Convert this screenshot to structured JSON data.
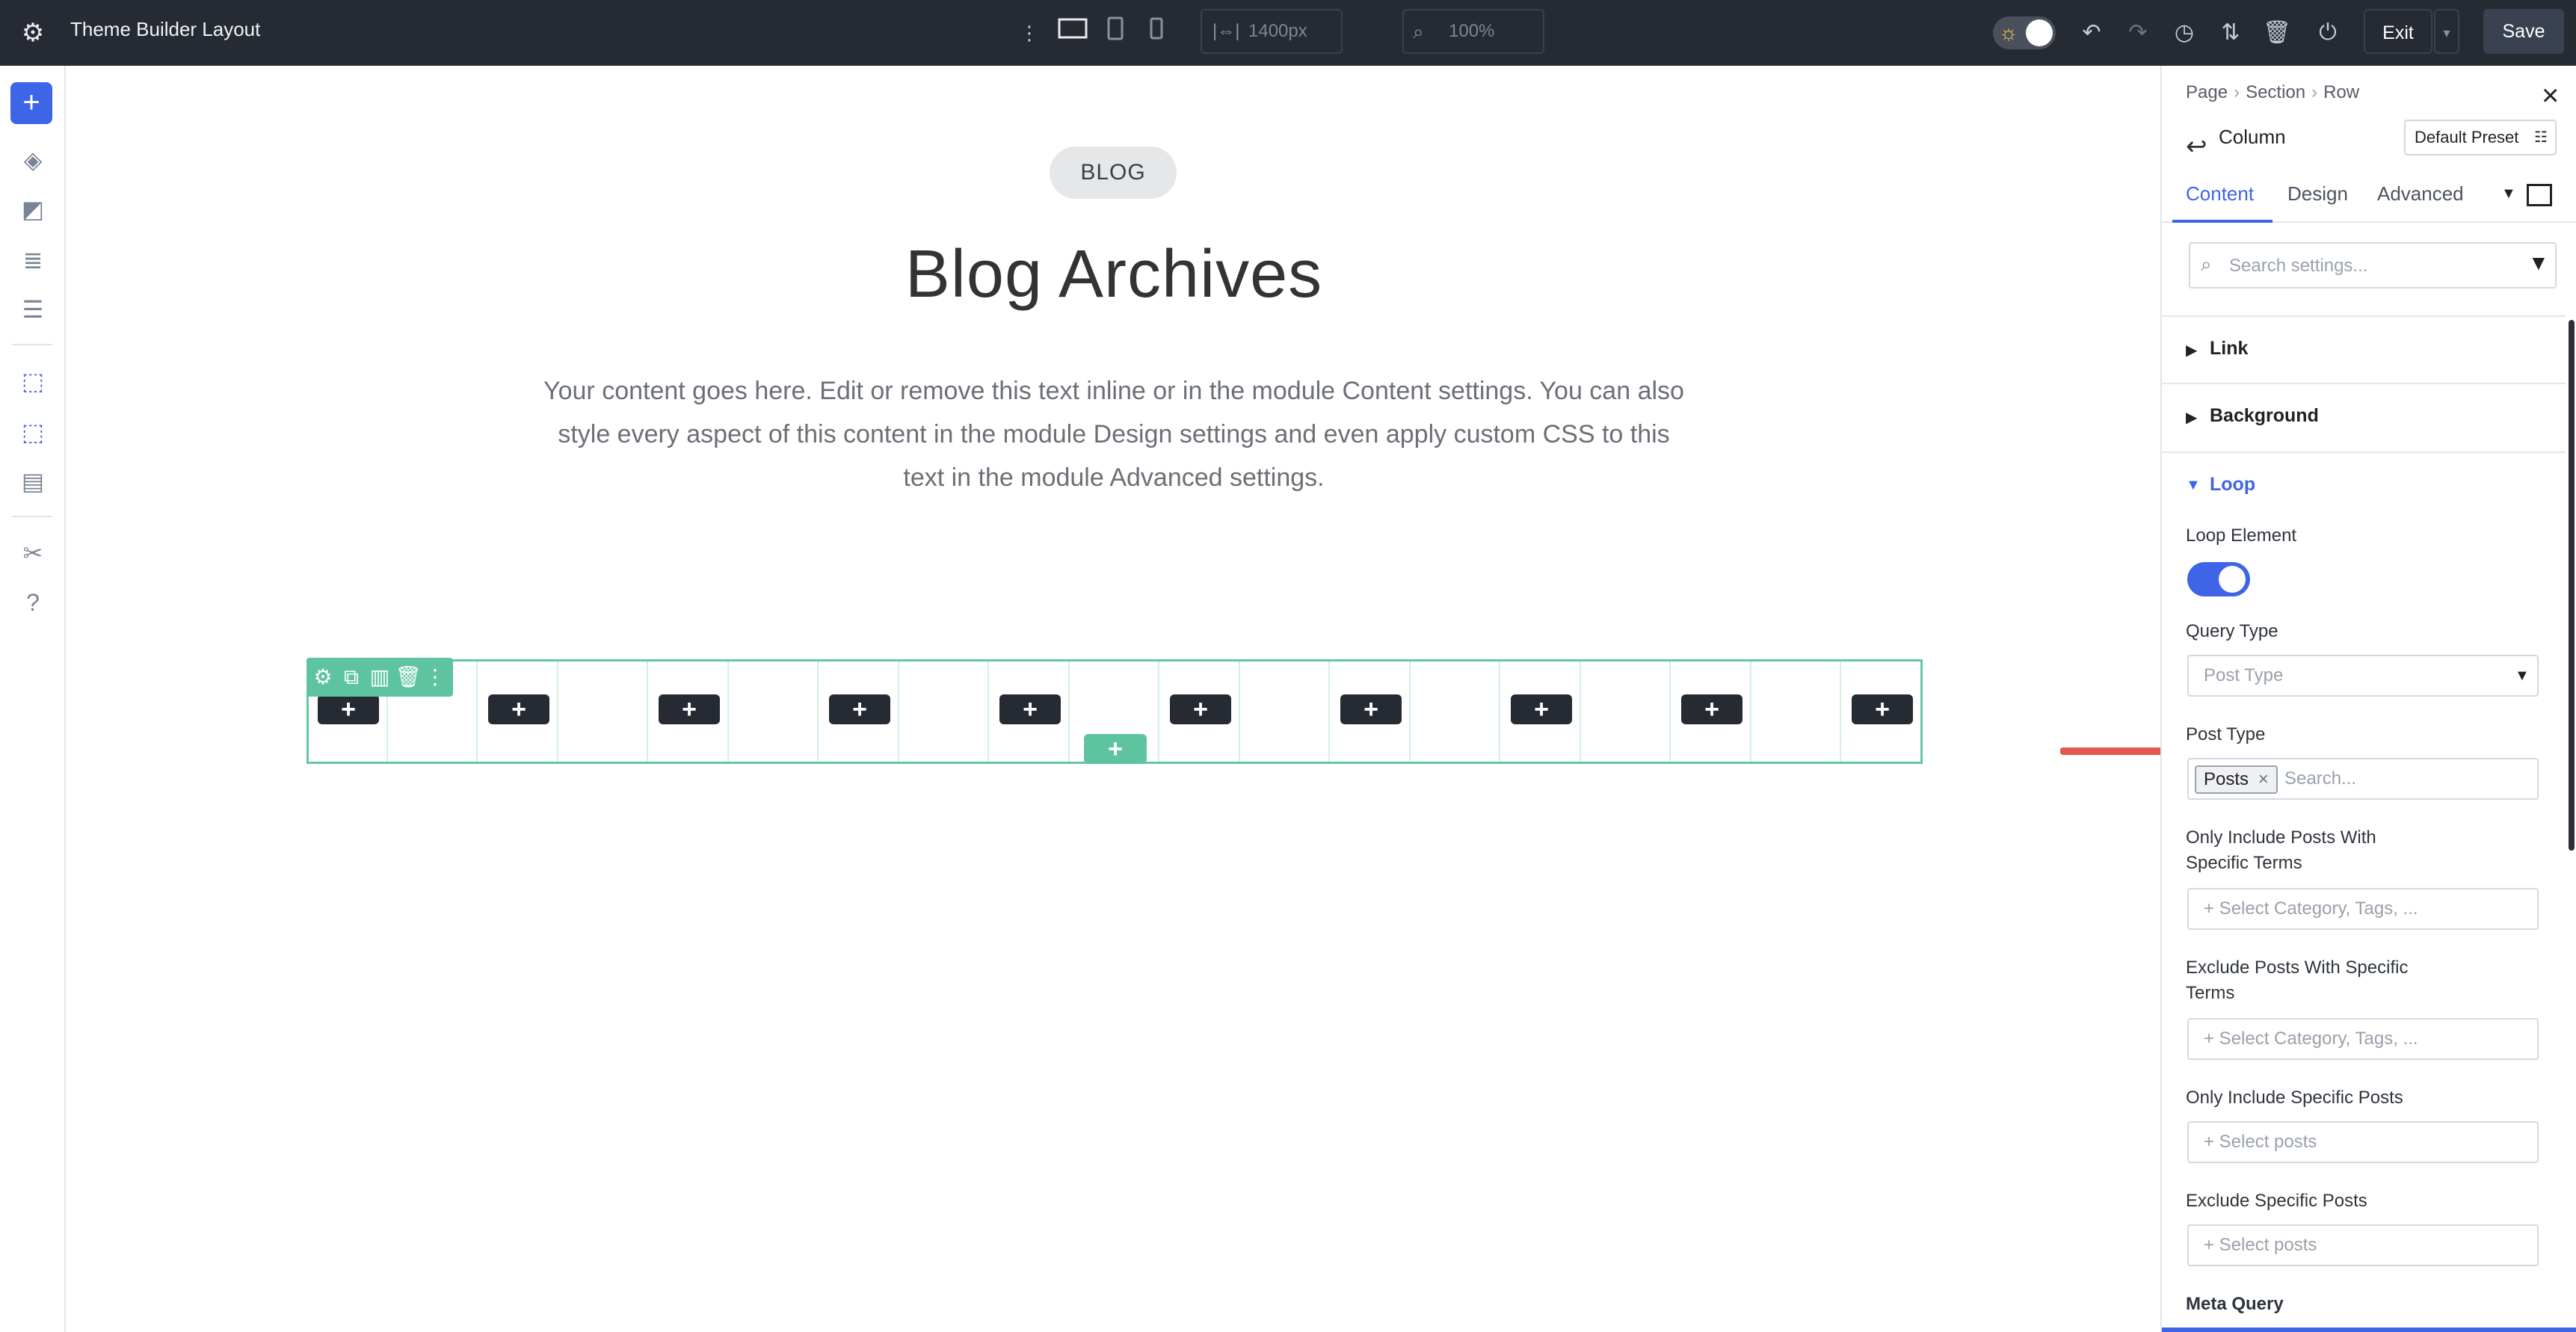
{
  "app": {
    "title": "Theme Builder Layout"
  },
  "toolbar": {
    "width_value": "1400px",
    "zoom_value": "100%",
    "exit_label": "Exit",
    "save_label": "Save"
  },
  "canvas": {
    "pill_label": "BLOG",
    "heading": "Blog Archives",
    "body_text": "Your content goes here. Edit or remove this text inline or in the module Content settings. You can also style every aspect of this content in the module Design settings and even apply custom CSS to this text in the module Advanced settings.",
    "add_buttons": [
      "+",
      "+",
      "+",
      "+",
      "+",
      "+",
      "+",
      "+",
      "+",
      "+"
    ],
    "row_add": "+"
  },
  "panel": {
    "breadcrumb": [
      "Page",
      "Section",
      "Row"
    ],
    "title": "Column",
    "preset": "Default Preset",
    "tabs": [
      "Content",
      "Design",
      "Advanced"
    ],
    "active_tab": "Content",
    "search_placeholder": "Search settings...",
    "sections": [
      "Link",
      "Background",
      "Loop"
    ],
    "loop": {
      "loop_element_label": "Loop Element",
      "loop_element_on": true,
      "query_type_label": "Query Type",
      "query_type_placeholder": "Post Type",
      "post_type_label": "Post Type",
      "post_type_chip": "Posts",
      "post_type_search": "Search...",
      "only_include_terms_label_1": "Only Include Posts With",
      "only_include_terms_label_2": "Specific Terms",
      "only_include_terms_placeholder": "+ Select Category, Tags, ...",
      "exclude_terms_label_1": "Exclude Posts With Specific",
      "exclude_terms_label_2": "Terms",
      "exclude_terms_placeholder": "+ Select Category, Tags, ...",
      "only_include_posts_label": "Only Include Specific Posts",
      "only_include_posts_placeholder": "+ Select posts",
      "exclude_posts_label": "Exclude Specific Posts",
      "exclude_posts_placeholder": "+ Select posts",
      "meta_query_label": "Meta Query"
    }
  },
  "colors": {
    "accent": "#3e64e8",
    "row_outline": "#64c6a5",
    "arrow": "#e5584f",
    "topbar": "#262b33"
  }
}
